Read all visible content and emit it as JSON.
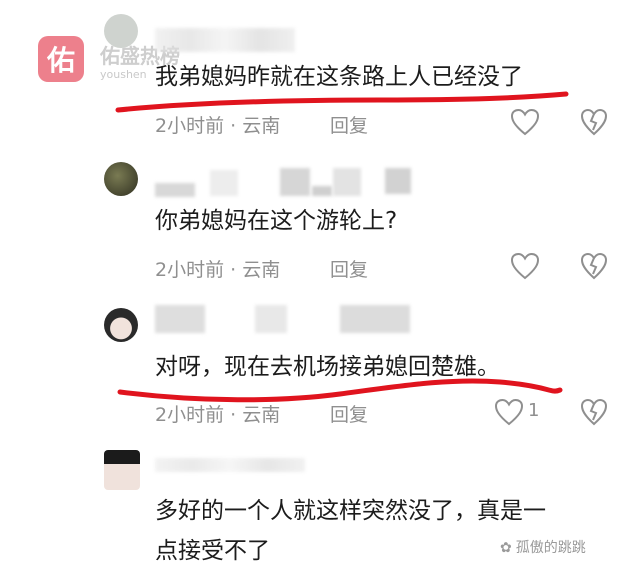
{
  "watermark": {
    "logo_char": "佑",
    "title": "佑盛热榜",
    "subtitle": "youshen"
  },
  "comments": [
    {
      "text": "我弟媳妈昨就在这条路上人已经没了",
      "time_location": "2小时前 · 云南",
      "reply_label": "回复",
      "underlined": true
    },
    {
      "text": "你弟媳妈在这个游轮上?",
      "time_location": "2小时前 · 云南",
      "reply_label": "回复",
      "underlined": false
    },
    {
      "text": "对呀，现在去机场接弟媳回楚雄。",
      "time_location": "2小时前 · 云南",
      "reply_label": "回复",
      "like_count": "1",
      "underlined": true
    },
    {
      "text_line1": "多好的一个人就这样突然没了，真是一",
      "text_line2": "点接受不了",
      "underlined": false
    }
  ],
  "bottom_watermark": "孤傲的跳跳",
  "colors": {
    "underline_red": "#e0141e",
    "meta_gray": "#8f8f8f",
    "watermark_pink": "#ea6b78"
  },
  "icons": [
    "heart-outline-icon",
    "broken-heart-icon",
    "paw-icon"
  ]
}
